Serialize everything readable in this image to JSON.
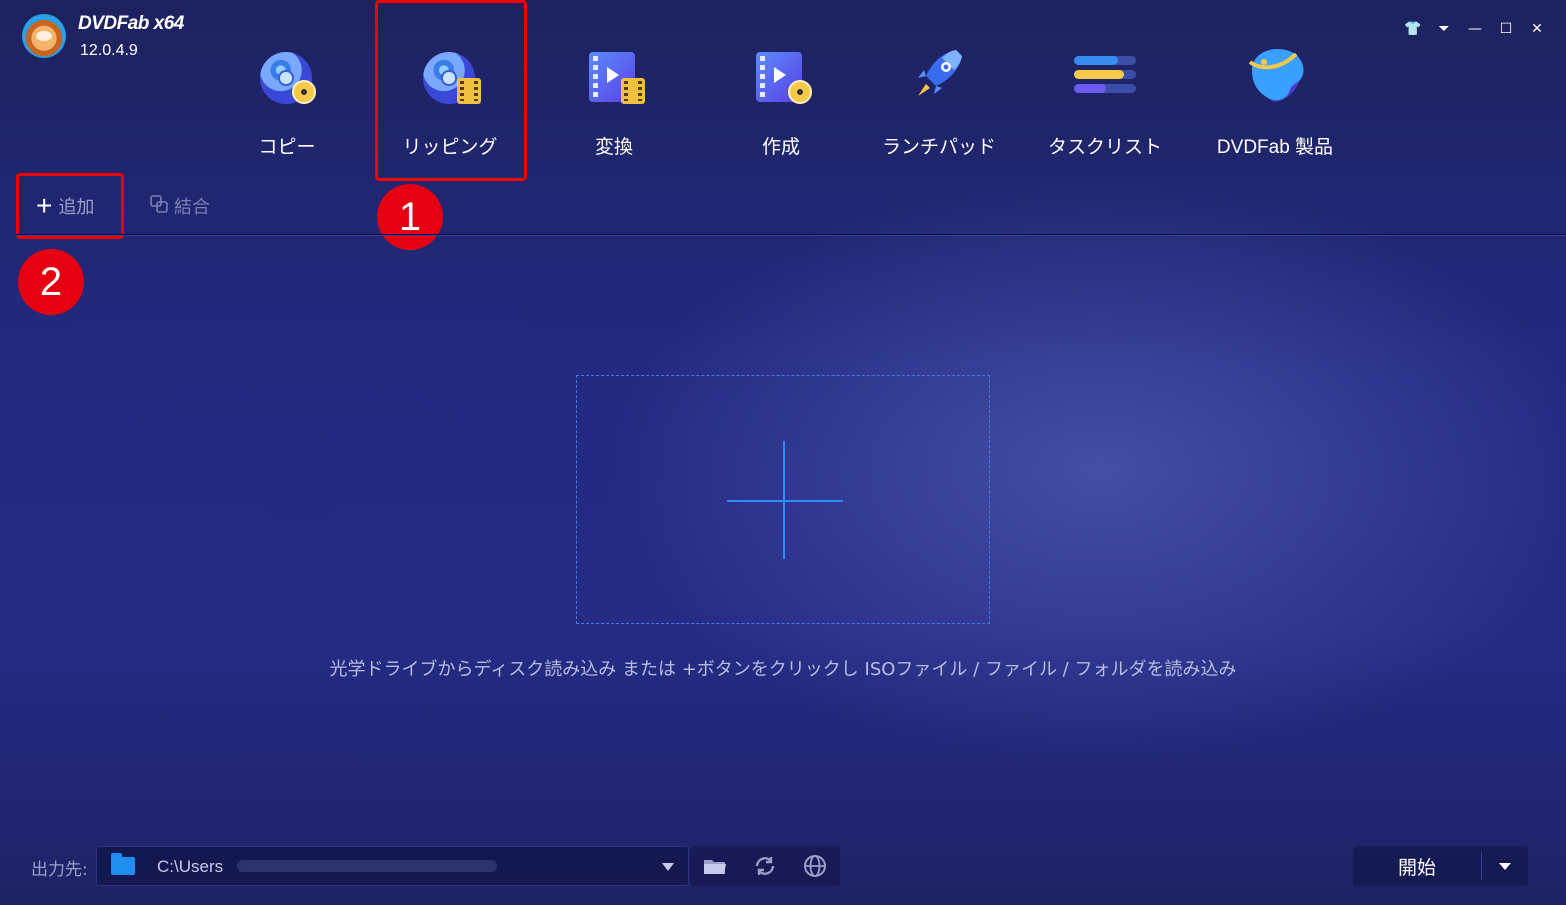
{
  "app": {
    "name": "DVDFab x64",
    "version": "12.0.4.9"
  },
  "window_controls": {
    "theme": "👕",
    "menu": "⏷",
    "minimize": "—",
    "maximize": "☐",
    "close": "✕"
  },
  "nav": {
    "copy": "コピー",
    "ripper": "リッピング",
    "converter": "変換",
    "creator": "作成",
    "launchpad": "ランチパッド",
    "tasklist": "タスクリスト",
    "products": "DVDFab 製品"
  },
  "toolbar": {
    "add_label": "追加",
    "merge_label": "結合"
  },
  "annotations": {
    "badge1": "1",
    "badge2": "2"
  },
  "dropzone": {
    "hint": "光学ドライブからディスク読み込み または +ボタンをクリックし ISOファイル / ファイル / フォルダを読み込み"
  },
  "output": {
    "label": "出力先:",
    "path": "C:\\Users"
  },
  "actions": {
    "start": "開始"
  },
  "colors": {
    "highlight": "#f20000",
    "badge": "#e60012",
    "accent": "#2b8fff"
  }
}
